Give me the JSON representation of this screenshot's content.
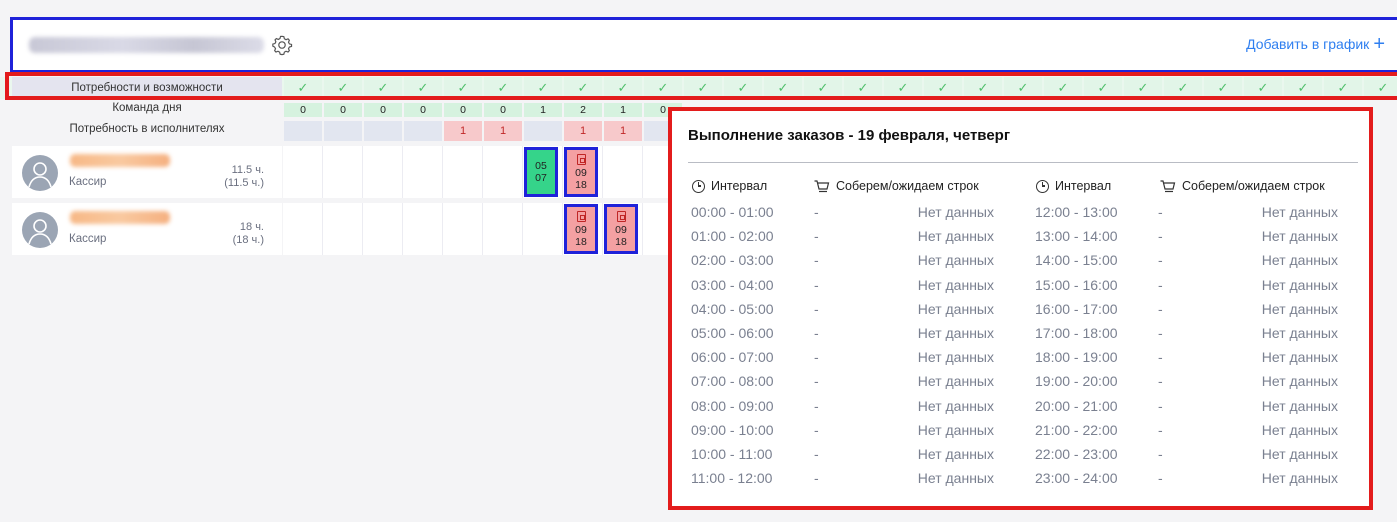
{
  "header": {
    "add_label": "Добавить в график"
  },
  "needs_row": {
    "label": "Потребности и возможности",
    "check": "✓"
  },
  "team_row": {
    "label": "Команда дня",
    "values": [
      "0",
      "0",
      "0",
      "0",
      "0",
      "0",
      "1",
      "2",
      "1",
      "0"
    ]
  },
  "demand_row": {
    "label": "Потребность в исполнителях",
    "values": [
      "",
      "",
      "",
      "",
      "1",
      "1",
      "",
      "1",
      "1",
      ""
    ]
  },
  "employees": [
    {
      "role": "Кассир",
      "hours": "11.5 ч.",
      "hours_sub": "(11.5 ч.)"
    },
    {
      "role": "Кассир",
      "hours": "18 ч.",
      "hours_sub": "(18 ч.)"
    }
  ],
  "shifts": [
    {
      "start": "05",
      "end": "07",
      "color": "#35d48a"
    },
    {
      "start": "09",
      "end": "18",
      "color": "#f4a0a2"
    },
    {
      "start": "09",
      "end": "18",
      "color": "#f4a0a2"
    },
    {
      "start": "09",
      "end": "18",
      "color": "#f4a0a2"
    }
  ],
  "popup": {
    "title": "Выполнение заказов - 19 февраля, четверг",
    "col_interval": "Интервал",
    "col_orders": "Соберем/ожидаем строк",
    "dash": "-",
    "no_data": "Нет данных",
    "left": [
      "00:00 - 01:00",
      "01:00 - 02:00",
      "02:00 - 03:00",
      "03:00 - 04:00",
      "04:00 - 05:00",
      "05:00 - 06:00",
      "06:00 - 07:00",
      "07:00 - 08:00",
      "08:00 - 09:00",
      "09:00 - 10:00",
      "10:00 - 11:00",
      "11:00 - 12:00"
    ],
    "right": [
      "12:00 - 13:00",
      "13:00 - 14:00",
      "14:00 - 15:00",
      "15:00 - 16:00",
      "16:00 - 17:00",
      "17:00 - 18:00",
      "18:00 - 19:00",
      "19:00 - 20:00",
      "20:00 - 21:00",
      "21:00 - 22:00",
      "22:00 - 23:00",
      "23:00 - 24:00"
    ]
  },
  "colors": {
    "accent_blue": "#2f7ff0",
    "highlight_red": "#e31c1c",
    "highlight_blue": "#1f22d9"
  }
}
